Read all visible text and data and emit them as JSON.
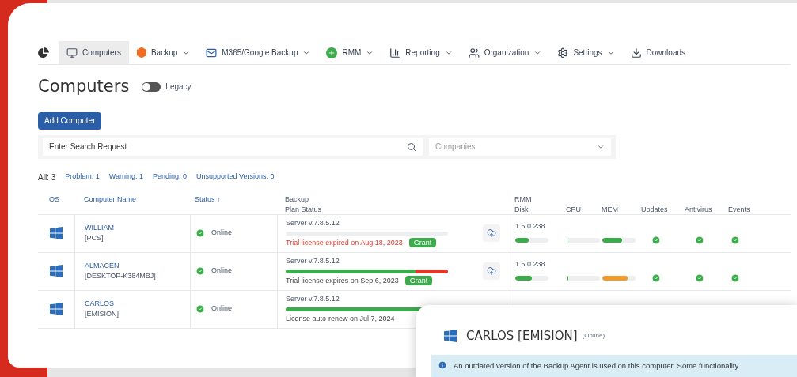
{
  "nav": [
    {
      "label": "Computers",
      "dropdown": false,
      "selected": true
    },
    {
      "label": "Backup",
      "dropdown": true,
      "selected": false
    },
    {
      "label": "M365/Google Backup",
      "dropdown": true,
      "selected": false
    },
    {
      "label": "RMM",
      "dropdown": true,
      "selected": false
    },
    {
      "label": "Reporting",
      "dropdown": true,
      "selected": false
    },
    {
      "label": "Organization",
      "dropdown": true,
      "selected": false
    },
    {
      "label": "Settings",
      "dropdown": true,
      "selected": false
    },
    {
      "label": "Downloads",
      "dropdown": false,
      "selected": false
    }
  ],
  "page_title": "Computers",
  "legacy_toggle": {
    "label": "Legacy",
    "on": false
  },
  "add_button": "Add Computer",
  "search": {
    "placeholder": "Enter Search Request"
  },
  "companies": {
    "placeholder": "Companies"
  },
  "filters": [
    {
      "label": "All: 3",
      "selected": true
    },
    {
      "label": "Problem: 1",
      "selected": false
    },
    {
      "label": "Warning: 1",
      "selected": false
    },
    {
      "label": "Pending: 0",
      "selected": false
    },
    {
      "label": "Unsupported Versions: 0",
      "selected": false
    }
  ],
  "columns": {
    "os": "OS",
    "name": "Computer Name",
    "status": "Status ↑",
    "backup": "Backup",
    "plan_status": "Plan Status",
    "rmm": "RMM",
    "disk": "Disk",
    "cpu": "CPU",
    "mem": "MEM",
    "updates": "Updates",
    "antivirus": "Antivirus",
    "events": "Events"
  },
  "rows": [
    {
      "name": "WILLIAM",
      "host": "[PCS]",
      "status": "Online",
      "version": "Server v.7.8.5.12",
      "backup_bar": [
        {
          "kind": "ok",
          "level": 0
        },
        {
          "kind": "fail",
          "level": 0
        }
      ],
      "license": "Trial license expired on Aug 18, 2023",
      "license_expired": true,
      "grant": "Grant",
      "upload_button": true,
      "rmm": {
        "version": "1.5.0.238",
        "disk": {
          "level": 0.4
        },
        "cpu": {
          "level": 0.02
        },
        "mem": {
          "level": 0.6,
          "color": "#3cab4b"
        },
        "updates": true,
        "antivirus": true,
        "events": true
      }
    },
    {
      "name": "ALMACEN",
      "host": "[DESKTOP-K384MBJ]",
      "status": "Online",
      "version": "Server v.7.8.5.12",
      "backup_bar": [
        {
          "kind": "ok",
          "level": 0.8
        },
        {
          "kind": "fail",
          "level": 0.2
        }
      ],
      "license": "Trial license expires on Sep 6, 2023",
      "license_expired": false,
      "grant": "Grant",
      "upload_button": true,
      "rmm": {
        "version": "1.5.0.238",
        "disk": {
          "level": 0.5
        },
        "cpu": {
          "level": 0.05
        },
        "mem": {
          "level": 0.75,
          "color": "#f39a2c"
        },
        "updates": true,
        "antivirus": true,
        "events": true
      }
    },
    {
      "name": "CARLOS",
      "host": "[EMISION]",
      "status": "Online",
      "version": "Server v.7.8.5.12",
      "backup_bar": [
        {
          "kind": "ok",
          "level": 1
        },
        {
          "kind": "fail",
          "level": 0
        }
      ],
      "license": "License auto-renew on Jul 7, 2024",
      "license_expired": false,
      "grant": null,
      "rmm": null
    }
  ],
  "detail_panel": {
    "title": "CARLOS [EMISION]",
    "status": "(Online)",
    "notice": "An outdated version of the Backup Agent is used on this computer. Some functionality"
  }
}
